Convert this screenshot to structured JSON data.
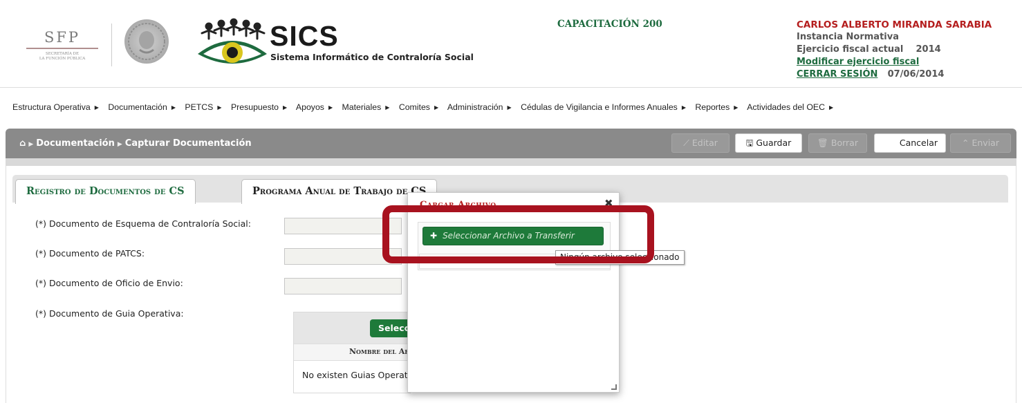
{
  "header": {
    "sfp": {
      "title": "SFP",
      "subtitle_line1": "Secretaría de",
      "subtitle_line2": "la Función Pública"
    },
    "app": {
      "title": "SICS",
      "subtitle": "Sistema Informático de Contraloría Social"
    },
    "environment": "CAPACITACIÓN 200",
    "user": {
      "name": "CARLOS ALBERTO MIRANDA SARABIA",
      "role": "Instancia Normativa",
      "fiscal_label": "Ejercicio fiscal actual",
      "fiscal_year": "2014",
      "modify_link": "Modificar ejercicio fiscal",
      "logout_link": "CERRAR SESIÓN",
      "date": "07/06/2014"
    }
  },
  "menu": [
    "Estructura Operativa",
    "Documentación",
    "PETCS",
    "Presupuesto",
    "Apoyos",
    "Materiales",
    "Comites",
    "Administración",
    "Cédulas de Vigilancia e Informes Anuales",
    "Reportes",
    "Actividades del OEC"
  ],
  "breadcrumb": {
    "section": "Documentación",
    "page": "Capturar Documentación"
  },
  "toolbar": {
    "edit": "Editar",
    "save": "Guardar",
    "delete": "Borrar",
    "cancel": "Cancelar",
    "send": "Enviar"
  },
  "tabs": {
    "tab1": "Registro de Documentos de CS",
    "tab2": "Programa Anual de Trabajo de CS"
  },
  "form": {
    "esquema": "(*) Documento de Esquema de Contraloría Social:",
    "patcs": "(*) Documento de PATCS:",
    "oficio": "(*) Documento de Oficio de Envio:",
    "guia": "(*) Documento de Guia Operativa:"
  },
  "guia_table": {
    "button": "Seleccionar Archivo",
    "column": "Nombre del Archivo",
    "empty": "No existen Guias Operativas"
  },
  "modal": {
    "title": "Cargar Archivo",
    "close": "✖",
    "select_button": "Seleccionar Archivo a Transferir",
    "tooltip": "Ningún archivo seleccionado"
  },
  "colors": {
    "brand_green": "#1e6b3f",
    "accent_red": "#b51e1e",
    "highlight_red": "#a8121f",
    "toolbar_grey": "#8a8a8a"
  }
}
